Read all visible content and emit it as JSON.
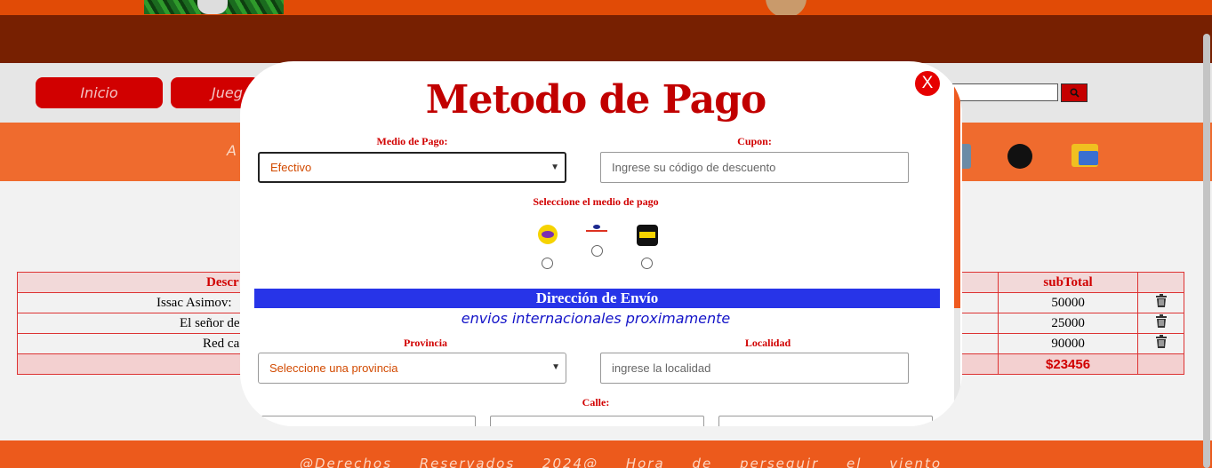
{
  "nav": {
    "items": [
      "Inicio",
      "Jueg"
    ]
  },
  "band": {
    "text": "A"
  },
  "cart": {
    "headers": [
      "Descr",
      "subTotal"
    ],
    "rows": [
      {
        "desc": "Issac Asimov:",
        "subtotal": "50000"
      },
      {
        "desc": "El señor de",
        "subtotal": "25000"
      },
      {
        "desc": "Red ca",
        "subtotal": "90000"
      }
    ],
    "total": "$23456"
  },
  "footer": {
    "text": "@Derechos Reservados 2024@ Hora de perseguir el viento"
  },
  "modal": {
    "title": "Metodo de Pago",
    "close_label": "X",
    "medio_label": "Medio de Pago:",
    "medio_value": "Efectivo",
    "cupon_label": "Cupon:",
    "cupon_placeholder": "Ingrese su código de descuento",
    "select_payment_label": "Seleccione el medio de pago",
    "ship_header": "Dirección de Envío",
    "ship_note": "envios internacionales proximamente",
    "provincia_label": "Provincia",
    "provincia_value": "Seleccione una provincia",
    "localidad_label": "Localidad",
    "localidad_placeholder": "ingrese la localidad",
    "calle_label": "Calle:"
  },
  "colors": {
    "accent": "#d10000",
    "brand_orange": "#ef6b2e",
    "ship_blue": "#2734e8"
  },
  "icons": [
    "trash-icon",
    "search-icon",
    "mastercard-icon",
    "credit-card-icon",
    "western-union-icon"
  ]
}
